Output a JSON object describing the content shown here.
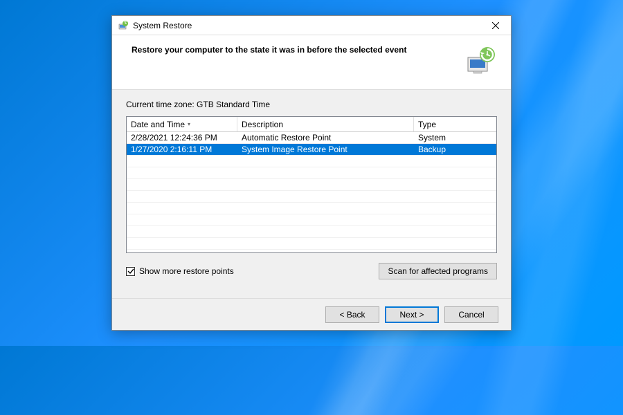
{
  "window": {
    "title": "System Restore"
  },
  "header": {
    "instruction": "Restore your computer to the state it was in before the selected event"
  },
  "timezone": {
    "label": "Current time zone: GTB Standard Time"
  },
  "table": {
    "columns": {
      "date": "Date and Time",
      "description": "Description",
      "type": "Type"
    },
    "rows": [
      {
        "date": "2/28/2021 12:24:36 PM",
        "description": "Automatic Restore Point",
        "type": "System",
        "selected": false
      },
      {
        "date": "1/27/2020 2:16:11 PM",
        "description": "System Image Restore Point",
        "type": "Backup",
        "selected": true
      }
    ]
  },
  "checkbox": {
    "label": "Show more restore points",
    "checked": true
  },
  "buttons": {
    "scan": "Scan for affected programs",
    "back": "< Back",
    "next": "Next >",
    "cancel": "Cancel"
  }
}
